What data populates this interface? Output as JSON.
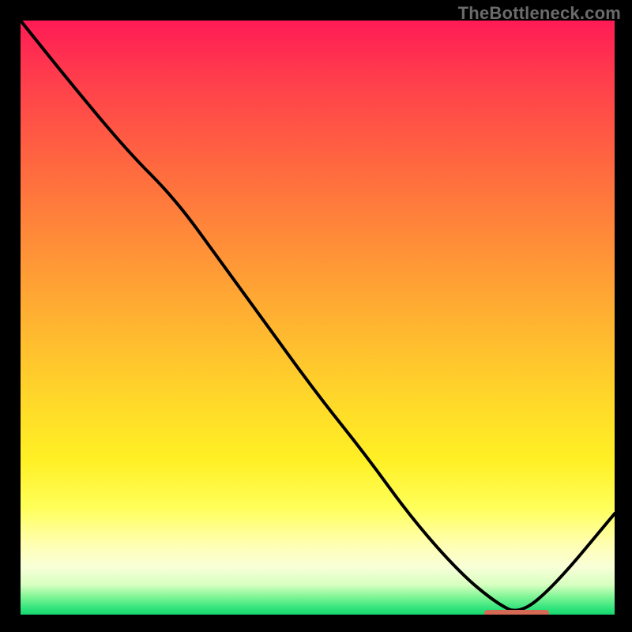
{
  "watermark": "TheBottleneck.com",
  "colors": {
    "accent_marker": "#d46a55",
    "curve": "#000000"
  },
  "chart_data": {
    "type": "line",
    "title": "",
    "xlabel": "",
    "ylabel": "",
    "xlim": [
      0,
      100
    ],
    "ylim": [
      0,
      100
    ],
    "grid": false,
    "legend": false,
    "series": [
      {
        "name": "bottleneck-curve",
        "x": [
          0,
          8,
          18,
          26,
          34,
          42,
          50,
          58,
          66,
          74,
          80,
          84,
          90,
          100
        ],
        "y": [
          100,
          90,
          78,
          70,
          59,
          48,
          37,
          27,
          16,
          7,
          2,
          0,
          5,
          17
        ]
      }
    ],
    "annotations": [
      {
        "name": "optimal-range-marker",
        "x_start": 78,
        "x_end": 89,
        "y": 0.2
      }
    ]
  }
}
